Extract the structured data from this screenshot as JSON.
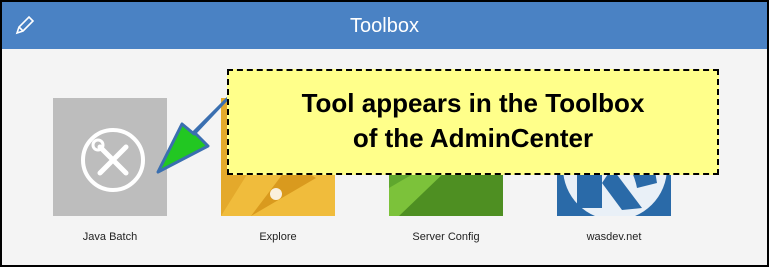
{
  "header": {
    "title": "Toolbox",
    "edit_icon": "pencil-icon"
  },
  "tools": [
    {
      "label": "Java Batch",
      "icon": "wrench-screwdriver-icon",
      "color": "#bdbdbd"
    },
    {
      "label": "Explore",
      "icon": "explore-compass-icon",
      "color": "#e4a92b"
    },
    {
      "label": "Server Config",
      "icon": "server-config-icon",
      "color": "#5fa72e"
    },
    {
      "label": "wasdev.net",
      "icon": "wasdev-logo-icon",
      "color": "#2a6aa8"
    }
  ],
  "callout": {
    "line1": "Tool appears in the Toolbox",
    "line2": "of the AdminCenter"
  },
  "colors": {
    "header": "#4a82c4",
    "callout_bg": "#ffff8a",
    "arrow": "#22c722"
  }
}
